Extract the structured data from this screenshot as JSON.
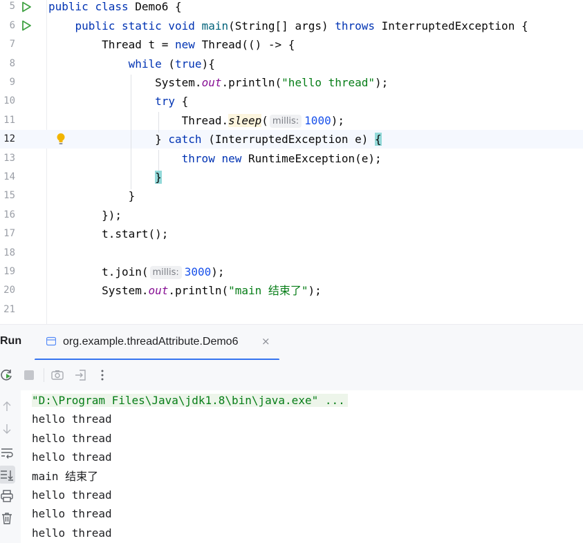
{
  "editor": {
    "lines": [
      {
        "num": "5",
        "tokens": [
          {
            "t": "public",
            "c": "kw"
          },
          {
            "t": " "
          },
          {
            "t": "class",
            "c": "kw"
          },
          {
            "t": " Demo6 {"
          }
        ]
      },
      {
        "num": "6",
        "tokens": [
          {
            "t": "    "
          },
          {
            "t": "public",
            "c": "kw"
          },
          {
            "t": " "
          },
          {
            "t": "static",
            "c": "kw"
          },
          {
            "t": " "
          },
          {
            "t": "void",
            "c": "kw"
          },
          {
            "t": " "
          },
          {
            "t": "main",
            "c": "fn"
          },
          {
            "t": "(String[] args) "
          },
          {
            "t": "throws",
            "c": "kw"
          },
          {
            "t": " InterruptedException {"
          }
        ]
      },
      {
        "num": "7",
        "tokens": [
          {
            "t": "        Thread t = "
          },
          {
            "t": "new",
            "c": "kw"
          },
          {
            "t": " Thread(() -> {"
          }
        ]
      },
      {
        "num": "8",
        "tokens": [
          {
            "t": "            "
          },
          {
            "t": "while",
            "c": "kw"
          },
          {
            "t": " ("
          },
          {
            "t": "true",
            "c": "kw"
          },
          {
            "t": "){"
          }
        ]
      },
      {
        "num": "9",
        "tokens": [
          {
            "t": "                System."
          },
          {
            "t": "out",
            "c": "fld"
          },
          {
            "t": ".println("
          },
          {
            "t": "\"hello thread\"",
            "c": "str"
          },
          {
            "t": ");"
          }
        ]
      },
      {
        "num": "10",
        "tokens": [
          {
            "t": "                "
          },
          {
            "t": "try",
            "c": "kw"
          },
          {
            "t": " {"
          }
        ]
      },
      {
        "num": "11",
        "tokens": [
          {
            "t": "                    Thread."
          },
          {
            "t": "sleep",
            "c": "hl-sleep"
          },
          {
            "t": "("
          },
          {
            "t": "millis:",
            "c": "hint"
          },
          {
            "t": "1000",
            "c": "num"
          },
          {
            "t": ");"
          }
        ]
      },
      {
        "num": "12",
        "current": true,
        "tokens": [
          {
            "t": "                } "
          },
          {
            "t": "catch",
            "c": "kw"
          },
          {
            "t": " (InterruptedException e) "
          },
          {
            "t": "{",
            "c": "brace-match"
          }
        ]
      },
      {
        "num": "13",
        "tokens": [
          {
            "t": "                    "
          },
          {
            "t": "throw",
            "c": "kw"
          },
          {
            "t": " "
          },
          {
            "t": "new",
            "c": "kw"
          },
          {
            "t": " RuntimeException(e);"
          }
        ]
      },
      {
        "num": "14",
        "tokens": [
          {
            "t": "                "
          },
          {
            "t": "}",
            "c": "brace-match"
          }
        ]
      },
      {
        "num": "15",
        "tokens": [
          {
            "t": "            }"
          }
        ]
      },
      {
        "num": "16",
        "tokens": [
          {
            "t": "        });"
          }
        ]
      },
      {
        "num": "17",
        "tokens": [
          {
            "t": "        t.start();"
          }
        ]
      },
      {
        "num": "18",
        "tokens": []
      },
      {
        "num": "19",
        "tokens": [
          {
            "t": "        t.join("
          },
          {
            "t": "millis:",
            "c": "hint"
          },
          {
            "t": "3000",
            "c": "num"
          },
          {
            "t": ");"
          }
        ]
      },
      {
        "num": "20",
        "tokens": [
          {
            "t": "        System."
          },
          {
            "t": "out",
            "c": "fld"
          },
          {
            "t": ".println("
          },
          {
            "t": "\"main 结束了\"",
            "c": "str"
          },
          {
            "t": ");"
          }
        ]
      },
      {
        "num": "21",
        "tokens": []
      }
    ]
  },
  "run_panel": {
    "title": "Run",
    "tab_label": "org.example.threadAttribute.Demo6",
    "tab_close": "×",
    "console_lines": [
      "\"D:\\Program Files\\Java\\jdk1.8\\bin\\java.exe\" ...",
      "hello thread",
      "hello thread",
      "hello thread",
      "main 结束了",
      "hello thread",
      "hello thread",
      "hello thread"
    ]
  },
  "colors": {
    "keyword": "#0033b3",
    "string": "#067d17",
    "number": "#1750eb",
    "field": "#871094",
    "accent": "#3574f0",
    "run_green": "#3fa142",
    "bulb_yellow": "#f2b500"
  },
  "icons": [
    "run-gutter-icon",
    "lightbulb-icon",
    "file-tab-icon",
    "close-icon",
    "rerun-icon",
    "stop-icon",
    "camera-icon",
    "exit-icon",
    "more-options-icon",
    "arrow-up-icon",
    "arrow-down-icon",
    "soft-wrap-icon",
    "scroll-to-end-icon",
    "print-icon",
    "trash-icon"
  ]
}
